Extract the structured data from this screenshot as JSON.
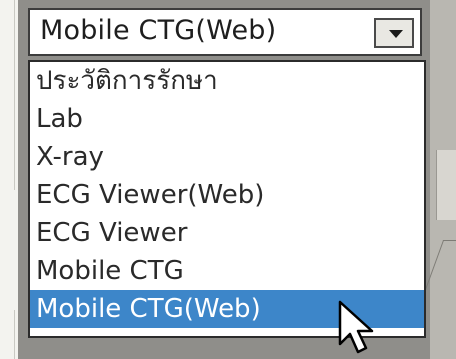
{
  "combo": {
    "value": "Mobile CTG(Web)",
    "button_icon": "chevron-down-icon"
  },
  "dropdown": {
    "items": [
      {
        "label": "ประวัติการรักษา",
        "selected": false
      },
      {
        "label": "Lab",
        "selected": false
      },
      {
        "label": "X-ray",
        "selected": false
      },
      {
        "label": "ECG Viewer(Web)",
        "selected": false
      },
      {
        "label": "ECG Viewer",
        "selected": false
      },
      {
        "label": "Mobile CTG",
        "selected": false
      },
      {
        "label": "Mobile CTG(Web)",
        "selected": true
      }
    ]
  },
  "colors": {
    "highlight": "#3d86c9",
    "highlight_text": "#ffffff",
    "list_background": "#ffffff"
  },
  "cursor_icon": "arrow-pointer-icon"
}
